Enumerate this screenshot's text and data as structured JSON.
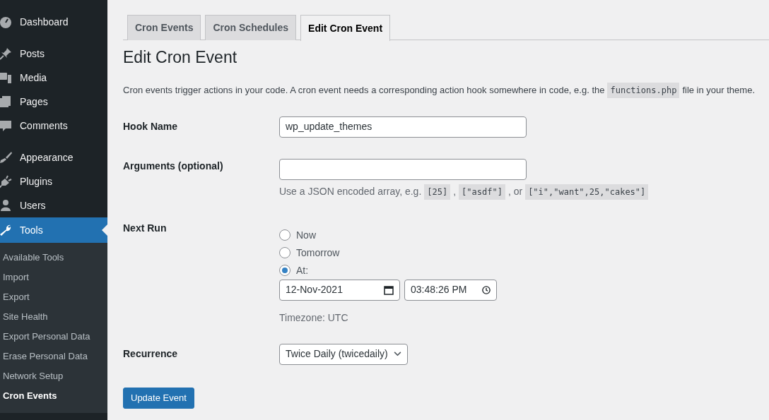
{
  "sidebar": {
    "items": [
      {
        "label": "Dashboard",
        "selected": false
      },
      {
        "label": "Posts",
        "selected": false
      },
      {
        "label": "Media",
        "selected": false
      },
      {
        "label": "Pages",
        "selected": false
      },
      {
        "label": "Comments",
        "selected": false
      },
      {
        "label": "Appearance",
        "selected": false
      },
      {
        "label": "Plugins",
        "selected": false
      },
      {
        "label": "Users",
        "selected": false
      },
      {
        "label": "Tools",
        "selected": true,
        "children": [
          {
            "label": "Available Tools",
            "selected": false
          },
          {
            "label": "Import",
            "selected": false
          },
          {
            "label": "Export",
            "selected": false
          },
          {
            "label": "Site Health",
            "selected": false
          },
          {
            "label": "Export Personal Data",
            "selected": false
          },
          {
            "label": "Erase Personal Data",
            "selected": false
          },
          {
            "label": "Network Setup",
            "selected": false
          },
          {
            "label": "Cron Events",
            "selected": true
          }
        ]
      }
    ]
  },
  "tabs": [
    {
      "label": "Cron Events",
      "selected": false
    },
    {
      "label": "Cron Schedules",
      "selected": false
    },
    {
      "label": "Edit Cron Event",
      "selected": true
    }
  ],
  "heading": "Edit Cron Event",
  "description": [
    {
      "kind": "text",
      "text": "Cron events trigger actions in your code. A cron event needs a corresponding action hook somewhere in code, e.g. the"
    },
    {
      "kind": "code",
      "text": "functions.php"
    },
    {
      "kind": "text",
      "text": "file in your theme."
    }
  ],
  "form": {
    "hook_name": {
      "label": "Hook Name",
      "value": "wp_update_themes"
    },
    "arguments": {
      "label": "Arguments (optional)",
      "help": [
        {
          "kind": "text",
          "text": "Use a JSON encoded array, e.g."
        },
        {
          "kind": "code",
          "text": "[25]"
        },
        {
          "kind": "text",
          "text": ","
        },
        {
          "kind": "code",
          "text": "[\"asdf\"]"
        },
        {
          "kind": "text",
          "text": ", or"
        },
        {
          "kind": "code",
          "text": "[\"i\",\"want\",25,\"cakes\"]"
        }
      ]
    },
    "next_run": {
      "label": "Next Run",
      "options": [
        {
          "label": "Now",
          "selected": false
        },
        {
          "label": "Tomorrow",
          "selected": false
        },
        {
          "label": "At:",
          "selected": true
        }
      ],
      "date": "12-Nov-2021",
      "time": "03:48:26 PM",
      "timezone": "Timezone: UTC"
    },
    "recurrence": {
      "label": "Recurrence",
      "value": "Twice Daily (twicedaily)"
    },
    "submit": "Update Event"
  }
}
